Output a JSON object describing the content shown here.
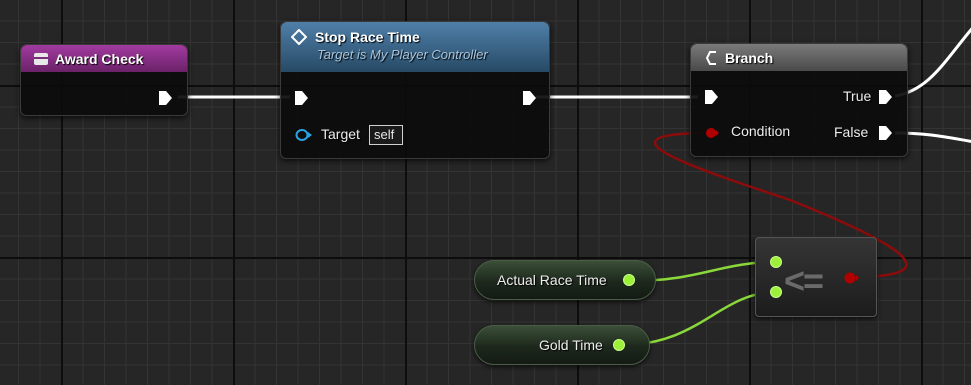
{
  "graph": {
    "nodes": {
      "award_check": {
        "title": "Award Check"
      },
      "stop_race_time": {
        "title": "Stop Race Time",
        "subtitle": "Target is My Player Controller",
        "target_label": "Target",
        "target_value": "self"
      },
      "branch": {
        "title": "Branch",
        "condition_label": "Condition",
        "true_label": "True",
        "false_label": "False"
      },
      "actual_race_time": {
        "label": "Actual Race Time"
      },
      "gold_time": {
        "label": "Gold Time"
      },
      "compare": {
        "symbol": "<="
      }
    },
    "colors": {
      "event_header": "#a23aa0",
      "function_header": "#4f7fa8",
      "branch_header": "#7a7a7a",
      "float_pin": "#9df03a",
      "bool_pin": "#b00000",
      "exec_pin": "#ffffff",
      "object_pin": "#2aa3e0"
    },
    "icons": {
      "event": "event-icon",
      "function": "function-icon",
      "branch": "branch-icon"
    }
  }
}
